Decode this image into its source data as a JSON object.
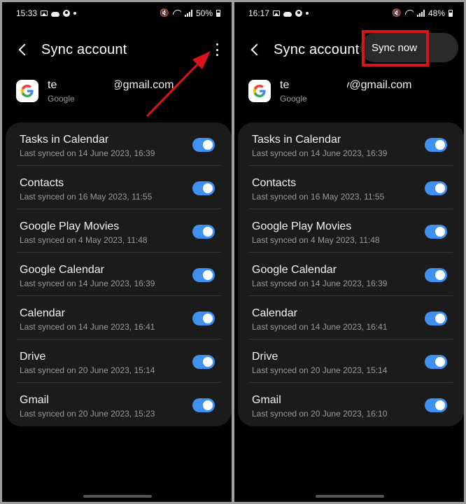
{
  "colors": {
    "toggle_on": "#3e91ef",
    "highlight": "#d9151b",
    "card": "#1b1b1b"
  },
  "left": {
    "status": {
      "time": "15:33",
      "battery": "50%"
    },
    "header": {
      "title": "Sync account"
    },
    "account": {
      "email_prefix": "te",
      "email_suffix": "@gmail.com",
      "provider": "Google"
    },
    "items": [
      {
        "name": "Tasks in Calendar",
        "sub": "Last synced on 14 June 2023, 16:39"
      },
      {
        "name": "Contacts",
        "sub": "Last synced on 16 May 2023, 11:55"
      },
      {
        "name": "Google Play Movies",
        "sub": "Last synced on 4 May 2023, 11:48"
      },
      {
        "name": "Google Calendar",
        "sub": "Last synced on 14 June 2023, 16:39"
      },
      {
        "name": "Calendar",
        "sub": "Last synced on 14 June 2023, 16:41"
      },
      {
        "name": "Drive",
        "sub": "Last synced on 20 June 2023, 15:14"
      },
      {
        "name": "Gmail",
        "sub": "Last synced on 20 June 2023, 15:23"
      }
    ]
  },
  "right": {
    "status": {
      "time": "16:17",
      "battery": "48%"
    },
    "header": {
      "title": "Sync account"
    },
    "menu": {
      "sync_now": "Sync now"
    },
    "account": {
      "email_prefix": "te",
      "email_suffix": "y@gmail.com",
      "provider": "Google"
    },
    "items": [
      {
        "name": "Tasks in Calendar",
        "sub": "Last synced on 14 June 2023, 16:39"
      },
      {
        "name": "Contacts",
        "sub": "Last synced on 16 May 2023, 11:55"
      },
      {
        "name": "Google Play Movies",
        "sub": "Last synced on 4 May 2023, 11:48"
      },
      {
        "name": "Google Calendar",
        "sub": "Last synced on 14 June 2023, 16:39"
      },
      {
        "name": "Calendar",
        "sub": "Last synced on 14 June 2023, 16:41"
      },
      {
        "name": "Drive",
        "sub": "Last synced on 20 June 2023, 15:14"
      },
      {
        "name": "Gmail",
        "sub": "Last synced on 20 June 2023, 16:10"
      }
    ]
  }
}
